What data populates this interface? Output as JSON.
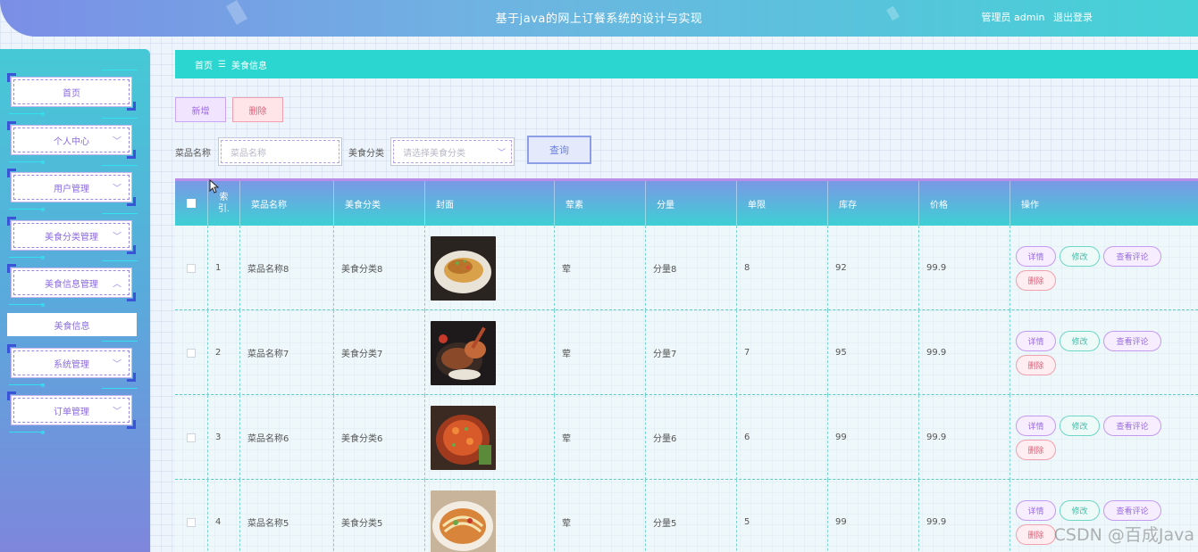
{
  "header": {
    "title": "基于java的网上订餐系统的设计与实现",
    "role_label": "管理员 admin",
    "logout_label": "退出登录"
  },
  "sidebar": {
    "items": [
      {
        "label": "首页",
        "expanded": false,
        "has_arrow": false
      },
      {
        "label": "个人中心",
        "expanded": false,
        "has_arrow": true
      },
      {
        "label": "用户管理",
        "expanded": false,
        "has_arrow": true
      },
      {
        "label": "美食分类管理",
        "expanded": false,
        "has_arrow": true
      },
      {
        "label": "美食信息管理",
        "expanded": true,
        "has_arrow": true
      },
      {
        "label": "系统管理",
        "expanded": false,
        "has_arrow": true
      },
      {
        "label": "订单管理",
        "expanded": false,
        "has_arrow": true
      }
    ],
    "submenu_active": "美食信息"
  },
  "breadcrumb": {
    "home": "首页",
    "separator": "☰",
    "current": "美食信息"
  },
  "actions": {
    "add_label": "新增",
    "delete_label": "删除"
  },
  "search": {
    "name_label": "菜品名称",
    "name_placeholder": "菜品名称",
    "category_label": "美食分类",
    "category_placeholder": "请选择美食分类",
    "query_label": "查询"
  },
  "table": {
    "headers": {
      "index": "索\n引.",
      "name": "菜品名称",
      "category": "美食分类",
      "cover": "封面",
      "type": "荤素",
      "portion": "分量",
      "limit": "单限",
      "stock": "库存",
      "price": "价格",
      "ops": "操作"
    },
    "rows": [
      {
        "index": "1",
        "name": "菜品名称8",
        "category": "美食分类8",
        "type": "荤",
        "portion": "分量8",
        "limit": "8",
        "stock": "92",
        "price": "99.9"
      },
      {
        "index": "2",
        "name": "菜品名称7",
        "category": "美食分类7",
        "type": "荤",
        "portion": "分量7",
        "limit": "7",
        "stock": "95",
        "price": "99.9"
      },
      {
        "index": "3",
        "name": "菜品名称6",
        "category": "美食分类6",
        "type": "荤",
        "portion": "分量6",
        "limit": "6",
        "stock": "99",
        "price": "99.9"
      },
      {
        "index": "4",
        "name": "菜品名称5",
        "category": "美食分类5",
        "type": "荤",
        "portion": "分量5",
        "limit": "5",
        "stock": "99",
        "price": "99.9"
      }
    ],
    "op_labels": {
      "detail": "详情",
      "edit": "修改",
      "review": "查看评论",
      "delete": "删除"
    }
  },
  "watermark": "CSDN @百成Java",
  "colors": {
    "accent_teal": "#2ad6cf",
    "accent_purple": "#9a6ae0",
    "danger": "#e0607a"
  }
}
